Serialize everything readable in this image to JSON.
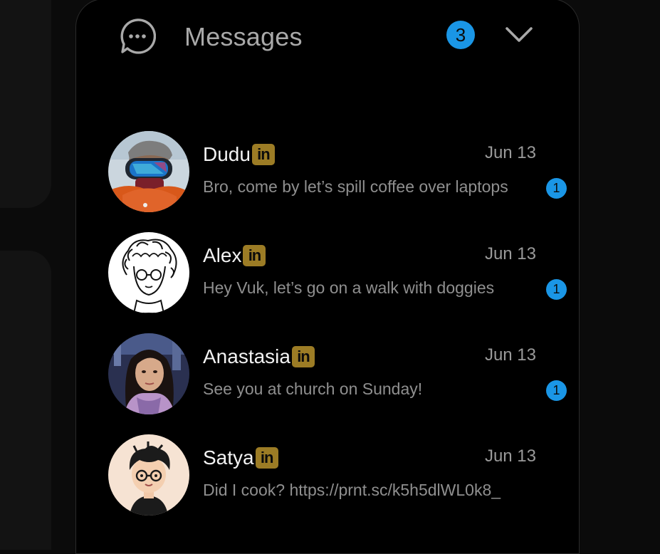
{
  "header": {
    "title": "Messages",
    "unread_count": "3",
    "icons": {
      "chat": "chat-bubble-icon",
      "toggle": "chevron-down-icon"
    }
  },
  "colors": {
    "accent_blue": "#1a96e6",
    "linkedin_gold": "#9c7c25",
    "background": "#000000"
  },
  "conversations": [
    {
      "name": "Dudu",
      "source_badge": "in",
      "date": "Jun 13",
      "preview": "Bro, come by let’s spill coffee over laptops",
      "unread": "1",
      "avatar": "avatar-goggles-photo"
    },
    {
      "name": "Alex",
      "source_badge": "in",
      "date": "Jun 13",
      "preview": "Hey Vuk, let’s go on a walk with doggies",
      "unread": "1",
      "avatar": "avatar-curly-hair-sketch"
    },
    {
      "name": "Anastasia",
      "source_badge": "in",
      "date": "Jun 13",
      "preview": "See you at church on Sunday!",
      "unread": "1",
      "avatar": "avatar-portrait-photo"
    },
    {
      "name": "Satya",
      "source_badge": "in",
      "date": "Jun 13",
      "preview": "Did I cook? https://prnt.sc/k5h5dlWL0k8_",
      "unread": "",
      "avatar": "avatar-cartoon-glasses"
    }
  ]
}
